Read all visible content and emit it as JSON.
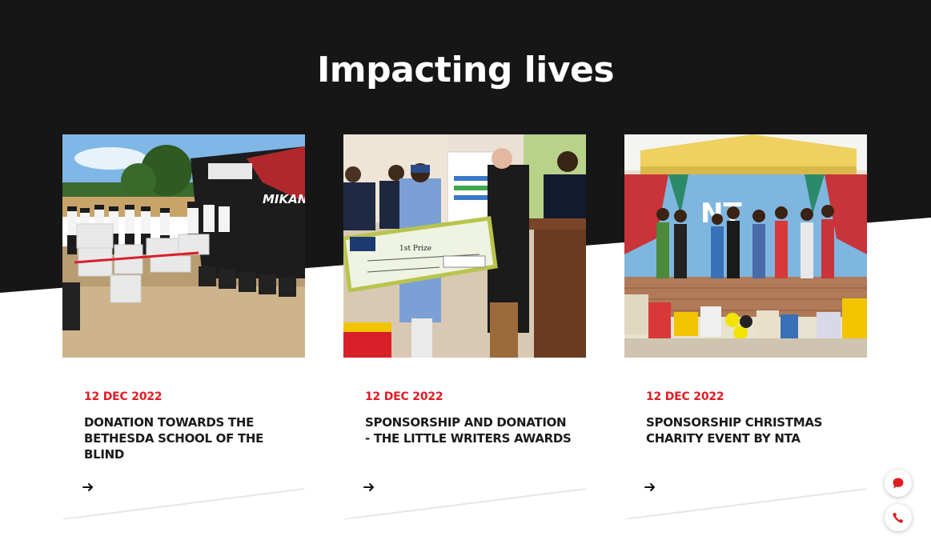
{
  "section": {
    "title": "Impacting lives"
  },
  "cards": [
    {
      "date": "12 DEC 2022",
      "title": "DONATION TOWARDS THE BETHESDA SCHOOL OF THE BLIND",
      "image_label": "MIKANO"
    },
    {
      "date": "12 DEC 2022",
      "title": "SPONSORSHIP AND DONATION - THE LITTLE WRITERS AWARDS",
      "image_label": "1st Prize"
    },
    {
      "date": "12 DEC 2022",
      "title": "SPONSORSHIP CHRISTMAS CHARITY EVENT BY NTA",
      "image_label": ""
    }
  ],
  "colors": {
    "accent": "#e31b23",
    "dark_band": "#161616",
    "text": "#1a1a1a"
  },
  "icons": {
    "card_link": "arrow-right-icon",
    "chat": "chat-bubble-icon",
    "call": "phone-icon"
  }
}
